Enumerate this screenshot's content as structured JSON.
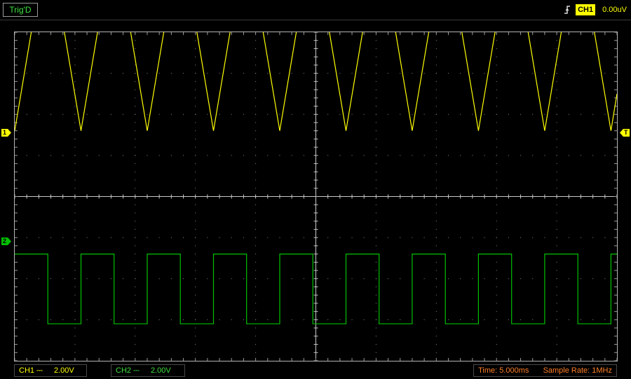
{
  "top": {
    "status": "Trig'D",
    "trigger_source": "CH1",
    "trigger_level": "0.00uV"
  },
  "markers": {
    "ch1": "1",
    "ch2": "2",
    "trigger": "T"
  },
  "bottom": {
    "ch1_label": "CH1",
    "ch1_coupling": "⎓",
    "ch1_scale": "2.00V",
    "ch2_label": "CH2",
    "ch2_coupling": "⎓",
    "ch2_scale": "2.00V",
    "time_label": "Time: 5.000ms",
    "sample_rate_label": "Sample Rate: 1MHz"
  },
  "colors": {
    "ch1": "#ffff00",
    "ch2": "#00c000",
    "grid": "#c8c8c8"
  },
  "icons": {
    "trigger_edge": "rising-edge-icon"
  },
  "chart_data": {
    "type": "line",
    "grid": {
      "divisions_x": 10,
      "divisions_y": 8
    },
    "series": [
      {
        "channel": "CH1",
        "shape": "triangle",
        "x_divs": [
          0.0,
          0.55,
          1.1,
          1.65,
          2.2,
          2.75,
          3.3,
          3.85,
          4.4,
          4.95,
          5.5,
          6.05,
          6.6,
          7.15,
          7.7,
          8.25,
          8.8,
          9.35,
          9.9,
          10.0
        ],
        "y_divs": [
          1.6,
          6.4,
          1.6,
          6.4,
          1.6,
          6.4,
          1.6,
          6.4,
          1.6,
          6.4,
          1.6,
          6.4,
          1.6,
          6.4,
          1.6,
          6.4,
          1.6,
          6.4,
          1.6,
          2.5
        ]
      },
      {
        "channel": "CH2",
        "shape": "square",
        "x_divs": [
          0.0,
          0.55,
          0.55,
          1.1,
          1.1,
          1.65,
          1.65,
          2.2,
          2.2,
          2.75,
          2.75,
          3.3,
          3.3,
          3.85,
          3.85,
          4.4,
          4.4,
          4.95,
          4.95,
          5.5,
          5.5,
          6.05,
          6.05,
          6.6,
          6.6,
          7.15,
          7.15,
          7.7,
          7.7,
          8.25,
          8.25,
          8.8,
          8.8,
          9.35,
          9.35,
          9.9,
          9.9,
          10.0
        ],
        "y_divs": [
          -1.4,
          -1.4,
          -3.1,
          -3.1,
          -1.4,
          -1.4,
          -3.1,
          -3.1,
          -1.4,
          -1.4,
          -3.1,
          -3.1,
          -1.4,
          -1.4,
          -3.1,
          -3.1,
          -1.4,
          -1.4,
          -3.1,
          -3.1,
          -1.4,
          -1.4,
          -3.1,
          -3.1,
          -1.4,
          -1.4,
          -3.1,
          -3.1,
          -1.4,
          -1.4,
          -3.1,
          -3.1,
          -1.4,
          -1.4,
          -3.1,
          -3.1,
          -1.4,
          -1.4
        ]
      }
    ]
  }
}
